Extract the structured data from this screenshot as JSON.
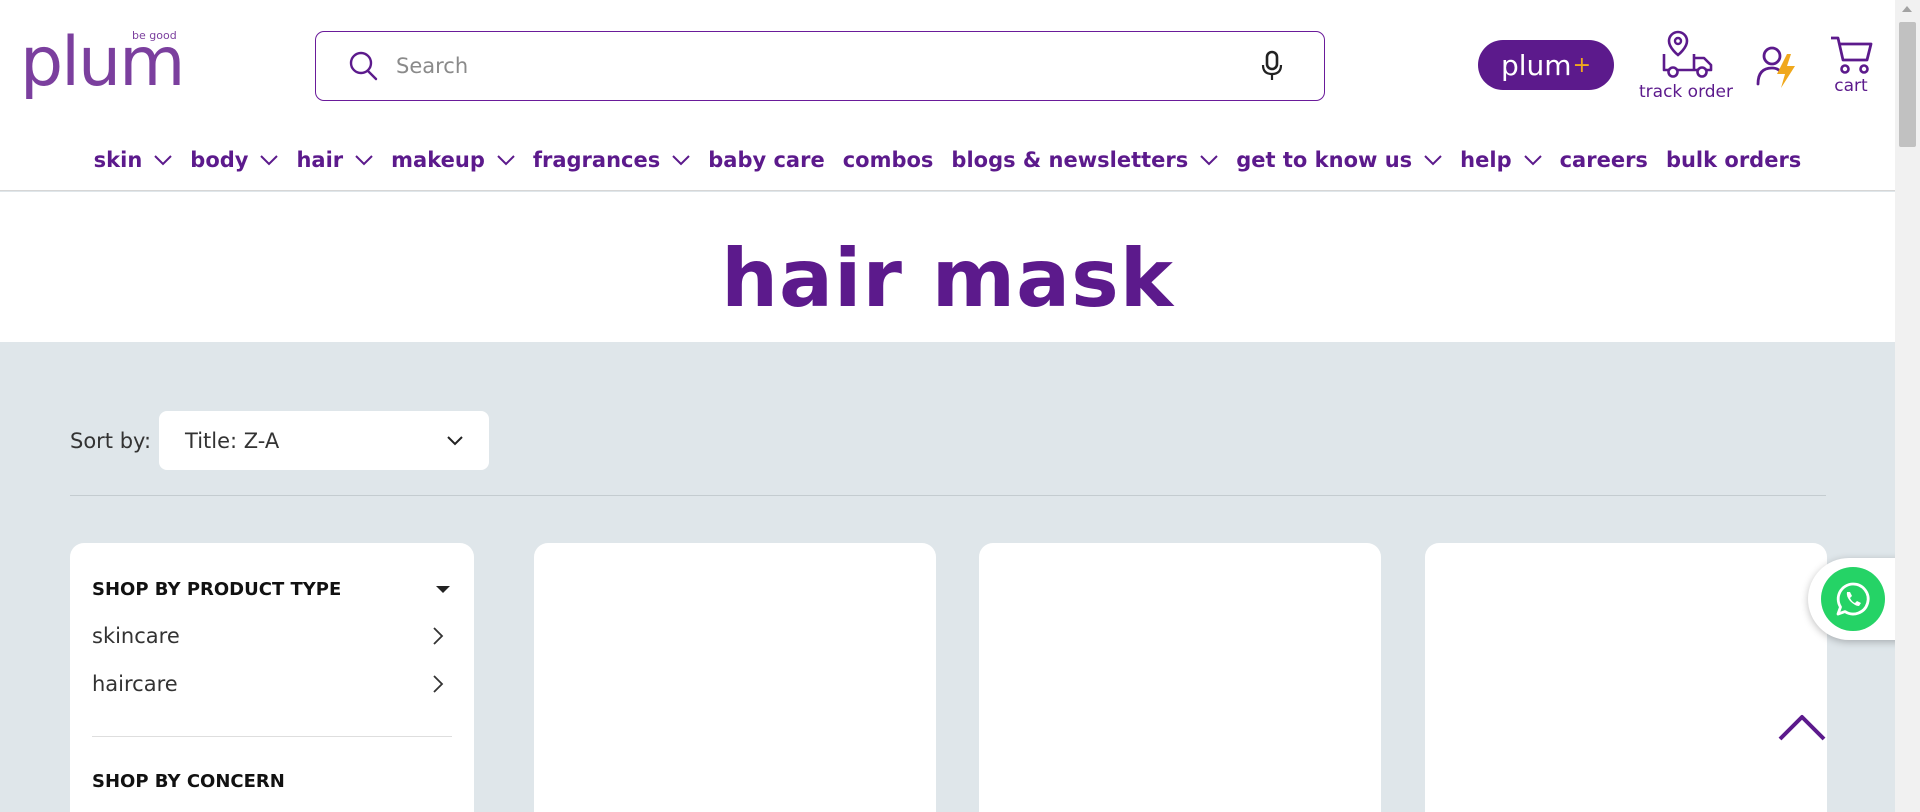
{
  "brand": {
    "name": "plum",
    "tagline": "be good"
  },
  "search": {
    "placeholder": "Search"
  },
  "header_actions": {
    "plum_plus_label": "plum",
    "plum_plus_symbol": "+",
    "track_order": "track order",
    "cart": "cart"
  },
  "nav": {
    "items": [
      {
        "label": "skin",
        "dropdown": true
      },
      {
        "label": "body",
        "dropdown": true
      },
      {
        "label": "hair",
        "dropdown": true
      },
      {
        "label": "makeup",
        "dropdown": true
      },
      {
        "label": "fragrances",
        "dropdown": true
      },
      {
        "label": "baby care",
        "dropdown": false
      },
      {
        "label": "combos",
        "dropdown": false
      },
      {
        "label": "blogs & newsletters",
        "dropdown": true
      },
      {
        "label": "get to know us",
        "dropdown": true
      },
      {
        "label": "help",
        "dropdown": true
      },
      {
        "label": "careers",
        "dropdown": false
      },
      {
        "label": "bulk orders",
        "dropdown": false
      }
    ]
  },
  "page": {
    "title": "hair mask"
  },
  "sort": {
    "label": "Sort by:",
    "selected": "Title: Z-A"
  },
  "filters": {
    "section_title": "SHOP BY PRODUCT TYPE",
    "items": [
      {
        "label": "skincare"
      },
      {
        "label": "haircare"
      }
    ],
    "next_section_title": "SHOP BY CONCERN"
  },
  "colors": {
    "brand_purple": "#5c1a8c",
    "logo_purple": "#7b3f9e",
    "accent_orange": "#f0a81c",
    "page_bg": "#dfe6ea",
    "whatsapp_green": "#25d366"
  }
}
